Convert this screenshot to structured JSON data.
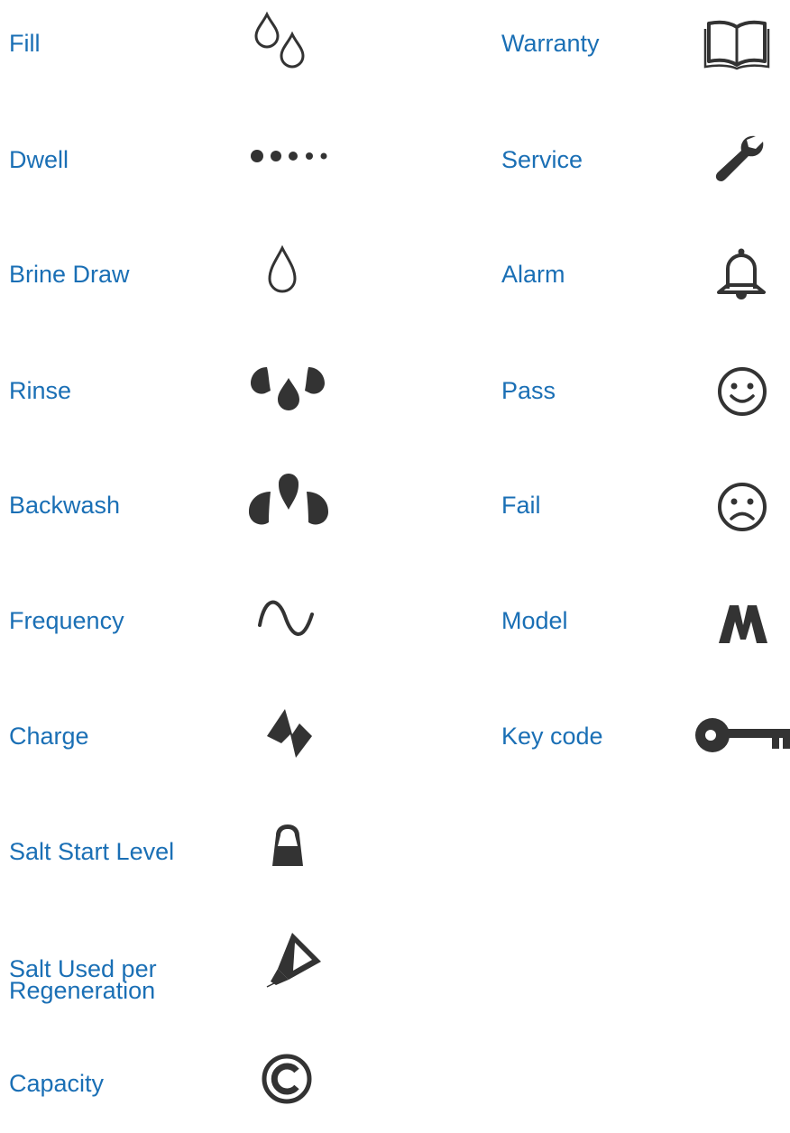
{
  "legend": {
    "left_column": [
      {
        "label": "Fill",
        "icon": "fill-icon"
      },
      {
        "label": "Dwell",
        "icon": "dwell-icon"
      },
      {
        "label": "Brine Draw",
        "icon": "brine-draw-icon"
      },
      {
        "label": "Rinse",
        "icon": "rinse-icon"
      },
      {
        "label": "Backwash",
        "icon": "backwash-icon"
      },
      {
        "label": "Frequency",
        "icon": "frequency-icon"
      },
      {
        "label": "Charge",
        "icon": "charge-icon"
      },
      {
        "label": "Salt Start Level",
        "icon": "salt-start-level-icon"
      },
      {
        "label": "Salt Used per Regeneration",
        "icon": "salt-used-icon"
      },
      {
        "label": "Capacity",
        "icon": "capacity-icon"
      }
    ],
    "right_column": [
      {
        "label": "Warranty",
        "icon": "warranty-icon"
      },
      {
        "label": "Service",
        "icon": "service-icon"
      },
      {
        "label": "Alarm",
        "icon": "alarm-icon"
      },
      {
        "label": "Pass",
        "icon": "pass-icon"
      },
      {
        "label": "Fail",
        "icon": "fail-icon"
      },
      {
        "label": "Model",
        "icon": "model-icon"
      },
      {
        "label": "Key code",
        "icon": "key-code-icon"
      }
    ],
    "colors": {
      "label": "#1a6fb5",
      "icon": "#333333"
    }
  }
}
